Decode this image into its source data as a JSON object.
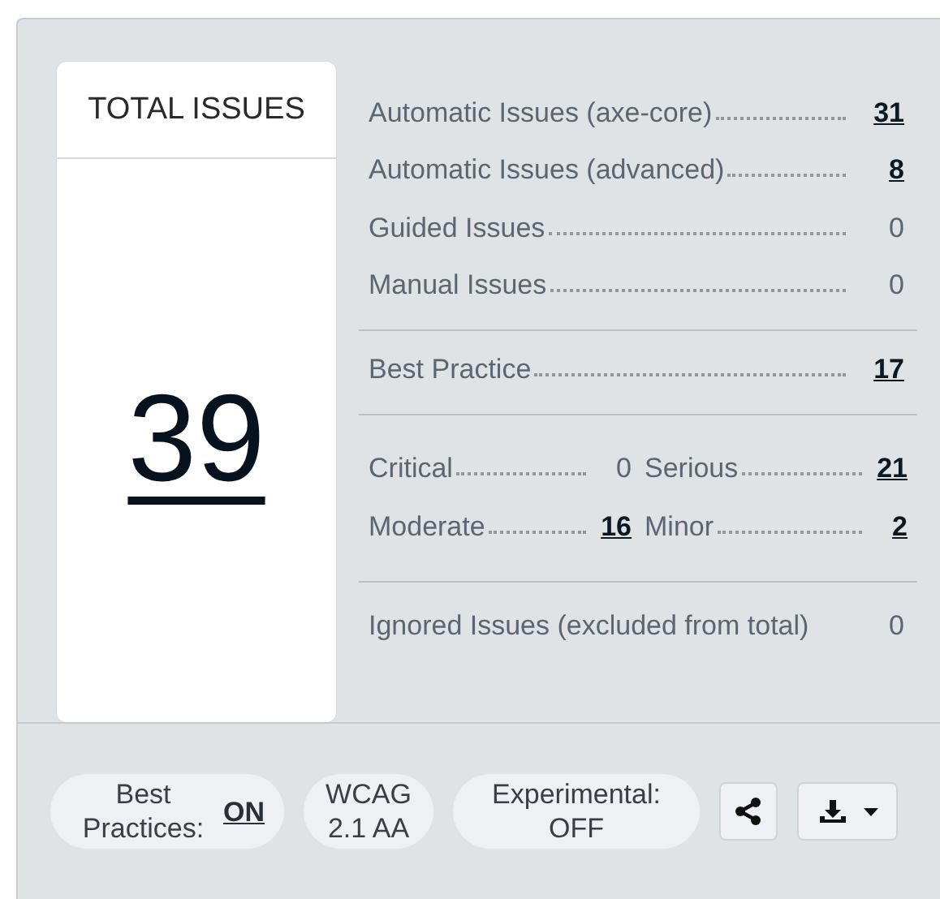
{
  "total": {
    "title": "TOTAL ISSUES",
    "count": "39"
  },
  "groups": [
    {
      "kind": "single",
      "rows": [
        {
          "label": "Automatic Issues (axe-core)",
          "value": "31",
          "link": true
        },
        {
          "label": "Automatic Issues (advanced)",
          "value": "8",
          "link": true
        },
        {
          "label": "Guided Issues",
          "value": "0",
          "link": false
        },
        {
          "label": "Manual Issues",
          "value": "0",
          "link": false
        }
      ]
    },
    {
      "kind": "single",
      "rows": [
        {
          "label": "Best Practice",
          "value": "17",
          "link": true
        }
      ]
    },
    {
      "kind": "pairs",
      "rows": [
        {
          "label": "Critical",
          "value": "0",
          "link": false
        },
        {
          "label": "Serious",
          "value": "21",
          "link": true
        },
        {
          "label": "Moderate",
          "value": "16",
          "link": true
        },
        {
          "label": "Minor",
          "value": "2",
          "link": true
        }
      ]
    },
    {
      "kind": "plain",
      "rows": [
        {
          "label": "Ignored Issues (excluded from total)",
          "value": "0",
          "link": false
        }
      ]
    }
  ],
  "footer": {
    "pills": [
      {
        "label": "Best Practices:",
        "value": "ON",
        "link": true
      },
      {
        "label": "WCAG 2.1 AA"
      },
      {
        "label": "Experimental: OFF"
      }
    ],
    "buttons": [
      {
        "kind": "share"
      },
      {
        "kind": "download"
      }
    ]
  }
}
